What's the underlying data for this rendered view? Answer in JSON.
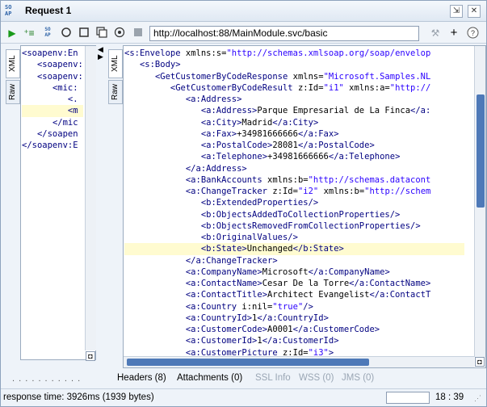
{
  "window": {
    "title": "Request 1",
    "title_icon_text": "SO\nAP",
    "buttons": [
      "detach-icon",
      "close-icon"
    ]
  },
  "toolbar": {
    "url": "http://localhost:88/MainModule.svc/basic",
    "icons": [
      "play-icon",
      "add-assertion-icon",
      "soap-icon",
      "stop-square-icon",
      "minimize-icon",
      "settings-icon",
      "stop-icon",
      "wrench-icon",
      "plus-icon",
      "help-icon"
    ]
  },
  "request_pane": {
    "tabs": [
      "XML",
      "Raw"
    ],
    "lines": [
      {
        "t": "<soapenv:En"
      },
      {
        "t": "   <soapenv:"
      },
      {
        "t": "   <soapenv:"
      },
      {
        "t": "      <mic:"
      },
      {
        "t": "         <."
      },
      {
        "t": "         <m",
        "hl": true
      },
      {
        "t": "      </mic"
      },
      {
        "t": "   </soapen"
      },
      {
        "t": "</soapenv:E"
      }
    ],
    "dots": ". . . . . . . . . . ."
  },
  "response_pane": {
    "tabs": [
      "XML",
      "Raw"
    ],
    "lines": [
      {
        "t": "<s:Envelope xmlns:s=\"http://schemas.xmlsoap.org/soap/envelop"
      },
      {
        "t": "   <s:Body>"
      },
      {
        "t": "      <GetCustomerByCodeResponse xmlns=\"Microsoft.Samples.NL"
      },
      {
        "t": "         <GetCustomerByCodeResult z:Id=\"i1\" xmlns:a=\"http://"
      },
      {
        "t": "            <a:Address>"
      },
      {
        "t": "               <a:Address>Parque Empresarial de La Finca</a:"
      },
      {
        "t": "               <a:City>Madrid</a:City>"
      },
      {
        "t": "               <a:Fax>+34981666666</a:Fax>"
      },
      {
        "t": "               <a:PostalCode>28081</a:PostalCode>"
      },
      {
        "t": "               <a:Telephone>+34981666666</a:Telephone>"
      },
      {
        "t": "            </a:Address>"
      },
      {
        "t": "            <a:BankAccounts xmlns:b=\"http://schemas.datacont"
      },
      {
        "t": "            <a:ChangeTracker z:Id=\"i2\" xmlns:b=\"http://schem"
      },
      {
        "t": "               <b:ExtendedProperties/>"
      },
      {
        "t": "               <b:ObjectsAddedToCollectionProperties/>"
      },
      {
        "t": "               <b:ObjectsRemovedFromCollectionProperties/>"
      },
      {
        "t": "               <b:OriginalValues/>"
      },
      {
        "t": "               <b:State>Unchanged</b:State>",
        "hl": true
      },
      {
        "t": "            </a:ChangeTracker>"
      },
      {
        "t": "            <a:CompanyName>Microsoft</a:CompanyName>"
      },
      {
        "t": "            <a:ContactName>Cesar De la Torre</a:ContactName>"
      },
      {
        "t": "            <a:ContactTitle>Architect Evangelist</a:ContactT"
      },
      {
        "t": "            <a:Country i:nil=\"true\"/>"
      },
      {
        "t": "            <a:CountryId>1</a:CountryId>"
      },
      {
        "t": "            <a:CustomerCode>A0001</a:CustomerCode>"
      },
      {
        "t": "            <a:CustomerId>1</a:CustomerId>"
      },
      {
        "t": "            <a:CustomerPicture z:Id=\"i3\">"
      }
    ]
  },
  "bottom_tabs": [
    {
      "label": "Headers (8)",
      "enabled": true
    },
    {
      "label": "Attachments (0)",
      "enabled": true
    },
    {
      "label": "SSL Info",
      "enabled": false
    },
    {
      "label": "WSS (0)",
      "enabled": false
    },
    {
      "label": "JMS (0)",
      "enabled": false
    }
  ],
  "status": {
    "response_time": "response time: 3926ms (1939 bytes)",
    "cursor": "18 : 39"
  }
}
